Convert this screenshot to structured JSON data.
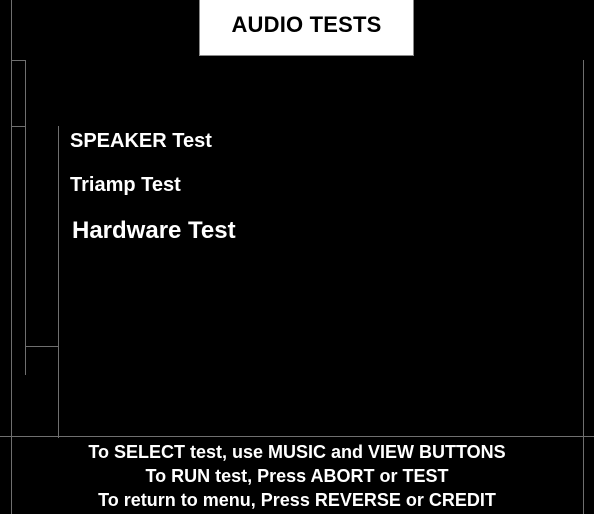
{
  "title": "AUDIO TESTS",
  "menu": {
    "items": [
      {
        "label": "SPEAKER Test"
      },
      {
        "label": "Triamp Test"
      },
      {
        "label": "Hardware Test"
      }
    ]
  },
  "footer": {
    "line1": "To SELECT test, use MUSIC and VIEW BUTTONS",
    "line2": "To RUN test, Press ABORT or TEST",
    "line3": "To return to menu, Press REVERSE or CREDIT"
  },
  "colors": {
    "background": "#000000",
    "text": "#ffffff",
    "title_box": "#ffffff",
    "title_text": "#000000",
    "guide_lines": "#6f6f6f"
  }
}
